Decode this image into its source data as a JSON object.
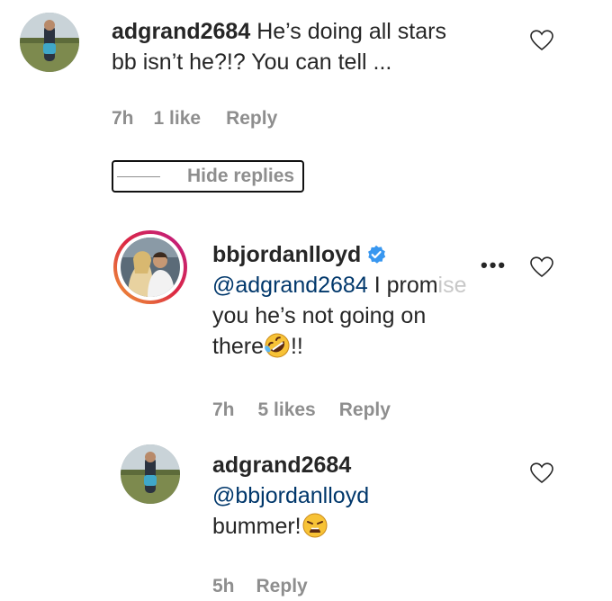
{
  "comments": [
    {
      "username": "adgrand2684",
      "text_line1": "He’s doing all stars",
      "text_line2": "bb isn’t he?!? You can tell ...",
      "time": "7h",
      "likes": "1 like",
      "reply": "Reply"
    }
  ],
  "hide_replies": "Hide replies",
  "replies": [
    {
      "username": "bbjordanlloyd",
      "verified": true,
      "mention": "@adgrand2684",
      "text_line1_rest": " I prom",
      "text_line1_faded": "ise",
      "text_line2": "you he’s not going on",
      "text_line3_pre": "there",
      "text_line3_post": "!!",
      "emoji": "rolling-on-floor-laughing",
      "more": "•••",
      "time": "7h",
      "likes": "5 likes",
      "reply": "Reply"
    },
    {
      "username": "adgrand2684",
      "mention": "@bbjordanlloyd",
      "text_line3": "bummer!",
      "emoji": "weary-face",
      "time": "5h",
      "reply": "Reply"
    }
  ],
  "colors": {
    "text": "#262626",
    "meta": "#8e8e8e",
    "mention": "#00376b",
    "verified": "#3897f0"
  }
}
